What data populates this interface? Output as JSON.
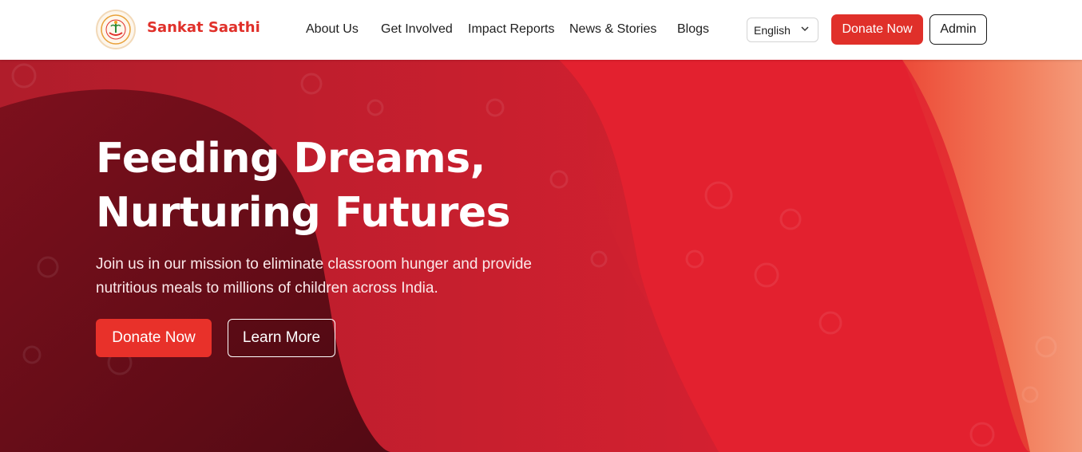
{
  "header": {
    "brand": "Sankat Saathi",
    "nav": [
      "About Us",
      "Get Involved",
      "Impact Reports",
      "News & Stories",
      "Blogs"
    ],
    "language": {
      "selected": "English"
    },
    "donate_label": "Donate Now",
    "admin_label": "Admin"
  },
  "hero": {
    "title_line1": "Feeding Dreams,",
    "title_line2": "Nurturing Futures",
    "subtitle_line1": "Join us in our mission to eliminate classroom hunger and provide",
    "subtitle_line2": "nutritious meals to millions of children across India.",
    "donate_label": "Donate Now",
    "learn_label": "Learn More"
  },
  "colors": {
    "brand_red": "#e0302a",
    "hero_dark": "#5a0a14",
    "hero_red": "#e12232",
    "hero_orange": "#f07a55"
  },
  "icons": {
    "logo": "circular-emblem-logo",
    "language_chevron": "chevron-down-icon"
  }
}
